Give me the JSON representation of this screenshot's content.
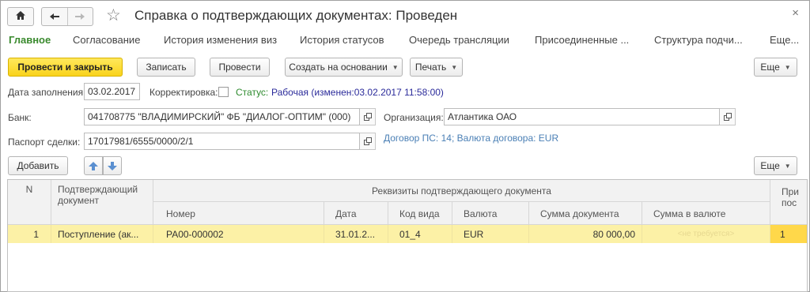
{
  "window": {
    "title": "Справка о подтверждающих документах: Проведен",
    "close_glyph": "×"
  },
  "tabs": [
    {
      "label": "Главное",
      "active": true
    },
    {
      "label": "Согласование"
    },
    {
      "label": "История изменения виз"
    },
    {
      "label": "История статусов"
    },
    {
      "label": "Очередь трансляции"
    },
    {
      "label": "Присоединенные ..."
    },
    {
      "label": "Структура подчи..."
    },
    {
      "label": "Еще..."
    }
  ],
  "toolbar": {
    "post_close": "Провести и закрыть",
    "save": "Записать",
    "post": "Провести",
    "create_based": "Создать на основании",
    "print": "Печать",
    "more": "Еще"
  },
  "form": {
    "date_label": "Дата заполнения:",
    "date_value": "03.02.2017",
    "correction_label": "Корректировка:",
    "status_label": "Статус:",
    "status_value": "Рабочая (изменен:03.02.2017 11:58:00)",
    "bank_label": "Банк:",
    "bank_value": "041708775 \"ВЛАДИМИРСКИЙ\" ФБ \"ДИАЛОГ-ОПТИМ\" (000)",
    "org_label": "Организация:",
    "org_value": "Атлантика ОАО",
    "passport_label": "Паспорт сделки:",
    "passport_value": "17017981/6555/0000/2/1",
    "contract_link": "Договор ПС: 14; Валюта договора: EUR"
  },
  "table_toolbar": {
    "add": "Добавить",
    "more": "Еще"
  },
  "table": {
    "headers": {
      "n": "N",
      "doc": "Подтверждающий документ",
      "group": "Реквизиты подтверждающего документа",
      "number": "Номер",
      "date": "Дата",
      "code": "Код вида",
      "currency": "Валюта",
      "sum_doc": "Сумма документа",
      "sum_cur": "Сумма в валюте",
      "extra_top": "При",
      "extra_bottom": "пос"
    },
    "rows": [
      {
        "n": "1",
        "doc": "Поступление (ак...",
        "number": "РА00-000002",
        "date": "31.01.2...",
        "code": "01_4",
        "currency": "EUR",
        "sum_doc": "80 000,00",
        "sum_cur": "<не требуется>",
        "extra": "1"
      }
    ]
  },
  "colors": {
    "accent_green": "#3a8a2e",
    "primary_button": "#f9d31c",
    "selected_row": "#fcf1a6",
    "status_value": "#2a2a9a",
    "link": "#4a7fb5"
  },
  "icons": [
    "home-icon",
    "back-arrow-icon",
    "forward-arrow-icon",
    "star-icon",
    "close-icon",
    "open-field-icon",
    "move-up-icon",
    "move-down-icon"
  ]
}
